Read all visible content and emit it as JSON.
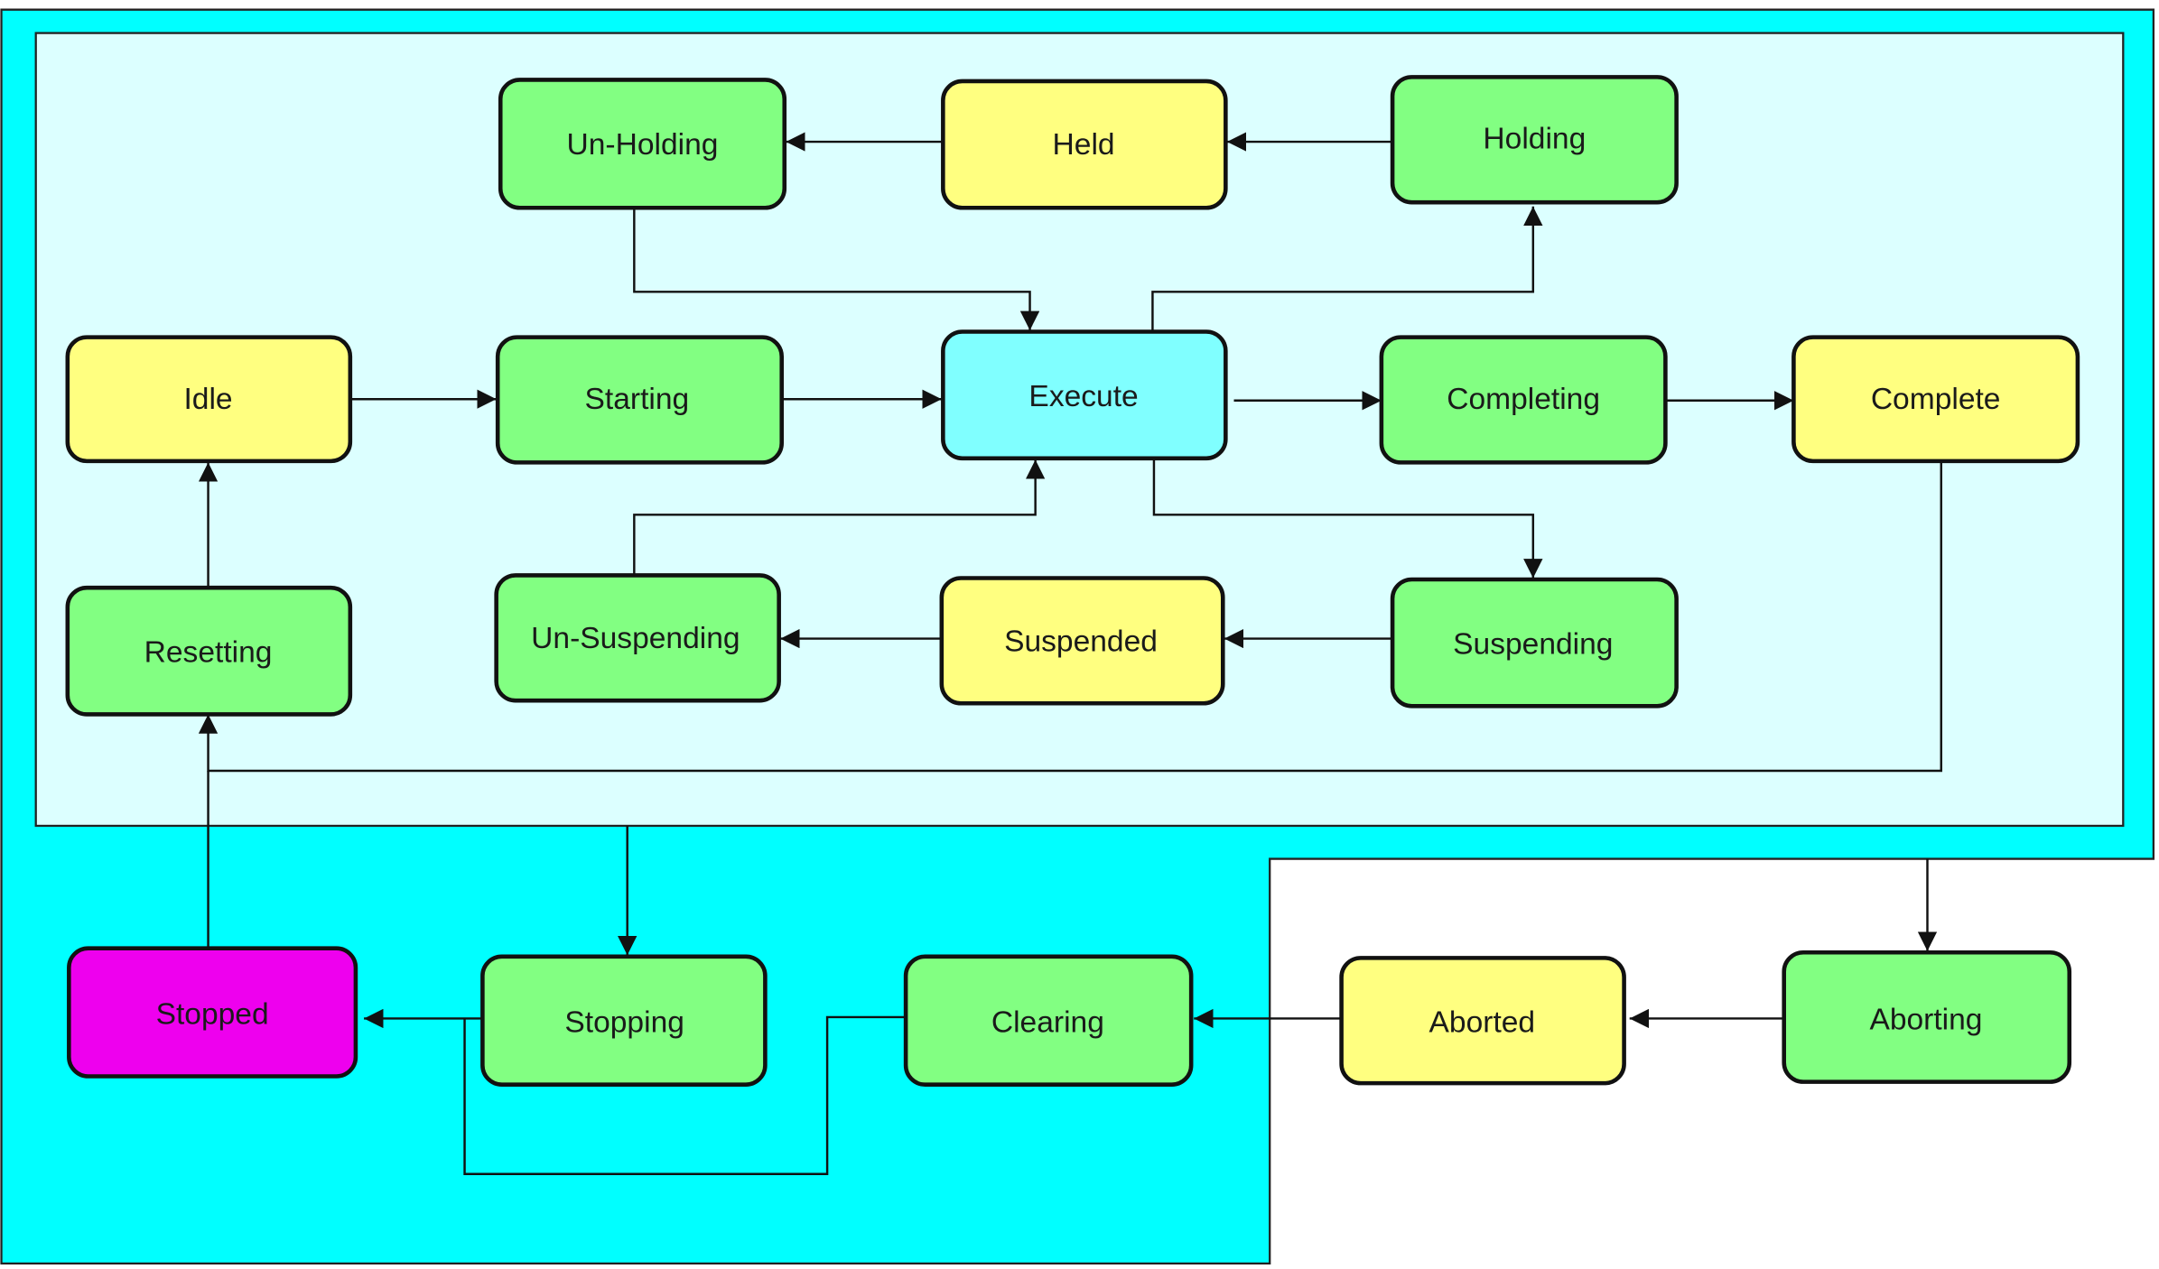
{
  "diagram": {
    "title": "",
    "colors": {
      "outer_region": "#00ffff",
      "inner_region": "#dcffff",
      "outside": "#ffffff",
      "acting_state": "#82ff82",
      "wait_state": "#ffff80",
      "execute_state": "#80ffff",
      "stopped_state": "#ee00ee",
      "border": "#111111"
    },
    "states": [
      {
        "id": "un-holding",
        "label": "Un-Holding",
        "kind": "acting"
      },
      {
        "id": "held",
        "label": "Held",
        "kind": "wait"
      },
      {
        "id": "holding",
        "label": "Holding",
        "kind": "acting"
      },
      {
        "id": "idle",
        "label": "Idle",
        "kind": "wait"
      },
      {
        "id": "starting",
        "label": "Starting",
        "kind": "acting"
      },
      {
        "id": "execute",
        "label": "Execute",
        "kind": "execute"
      },
      {
        "id": "completing",
        "label": "Completing",
        "kind": "acting"
      },
      {
        "id": "complete",
        "label": "Complete",
        "kind": "wait"
      },
      {
        "id": "resetting",
        "label": "Resetting",
        "kind": "acting"
      },
      {
        "id": "un-suspending",
        "label": "Un-Suspending",
        "kind": "acting"
      },
      {
        "id": "suspended",
        "label": "Suspended",
        "kind": "wait"
      },
      {
        "id": "suspending",
        "label": "Suspending",
        "kind": "acting"
      },
      {
        "id": "stopped",
        "label": "Stopped",
        "kind": "stopped"
      },
      {
        "id": "stopping",
        "label": "Stopping",
        "kind": "acting"
      },
      {
        "id": "clearing",
        "label": "Clearing",
        "kind": "acting"
      },
      {
        "id": "aborted",
        "label": "Aborted",
        "kind": "wait"
      },
      {
        "id": "aborting",
        "label": "Aborting",
        "kind": "acting"
      }
    ],
    "transitions": [
      {
        "from": "holding",
        "to": "held"
      },
      {
        "from": "held",
        "to": "un-holding"
      },
      {
        "from": "un-holding",
        "to": "execute"
      },
      {
        "from": "execute",
        "to": "holding"
      },
      {
        "from": "idle",
        "to": "starting"
      },
      {
        "from": "starting",
        "to": "execute"
      },
      {
        "from": "execute",
        "to": "completing"
      },
      {
        "from": "completing",
        "to": "complete"
      },
      {
        "from": "execute",
        "to": "suspending"
      },
      {
        "from": "suspending",
        "to": "suspended"
      },
      {
        "from": "suspended",
        "to": "un-suspending"
      },
      {
        "from": "un-suspending",
        "to": "execute"
      },
      {
        "from": "resetting",
        "to": "idle"
      },
      {
        "from": "complete",
        "to": "resetting"
      },
      {
        "from": "stopped",
        "to": "resetting"
      },
      {
        "from": "inner-region",
        "to": "stopping"
      },
      {
        "from": "stopping",
        "to": "stopped"
      },
      {
        "from": "clearing",
        "to": "stopping"
      },
      {
        "from": "aborted",
        "to": "clearing"
      },
      {
        "from": "aborting",
        "to": "aborted"
      },
      {
        "from": "outer-region",
        "to": "aborting"
      }
    ]
  }
}
